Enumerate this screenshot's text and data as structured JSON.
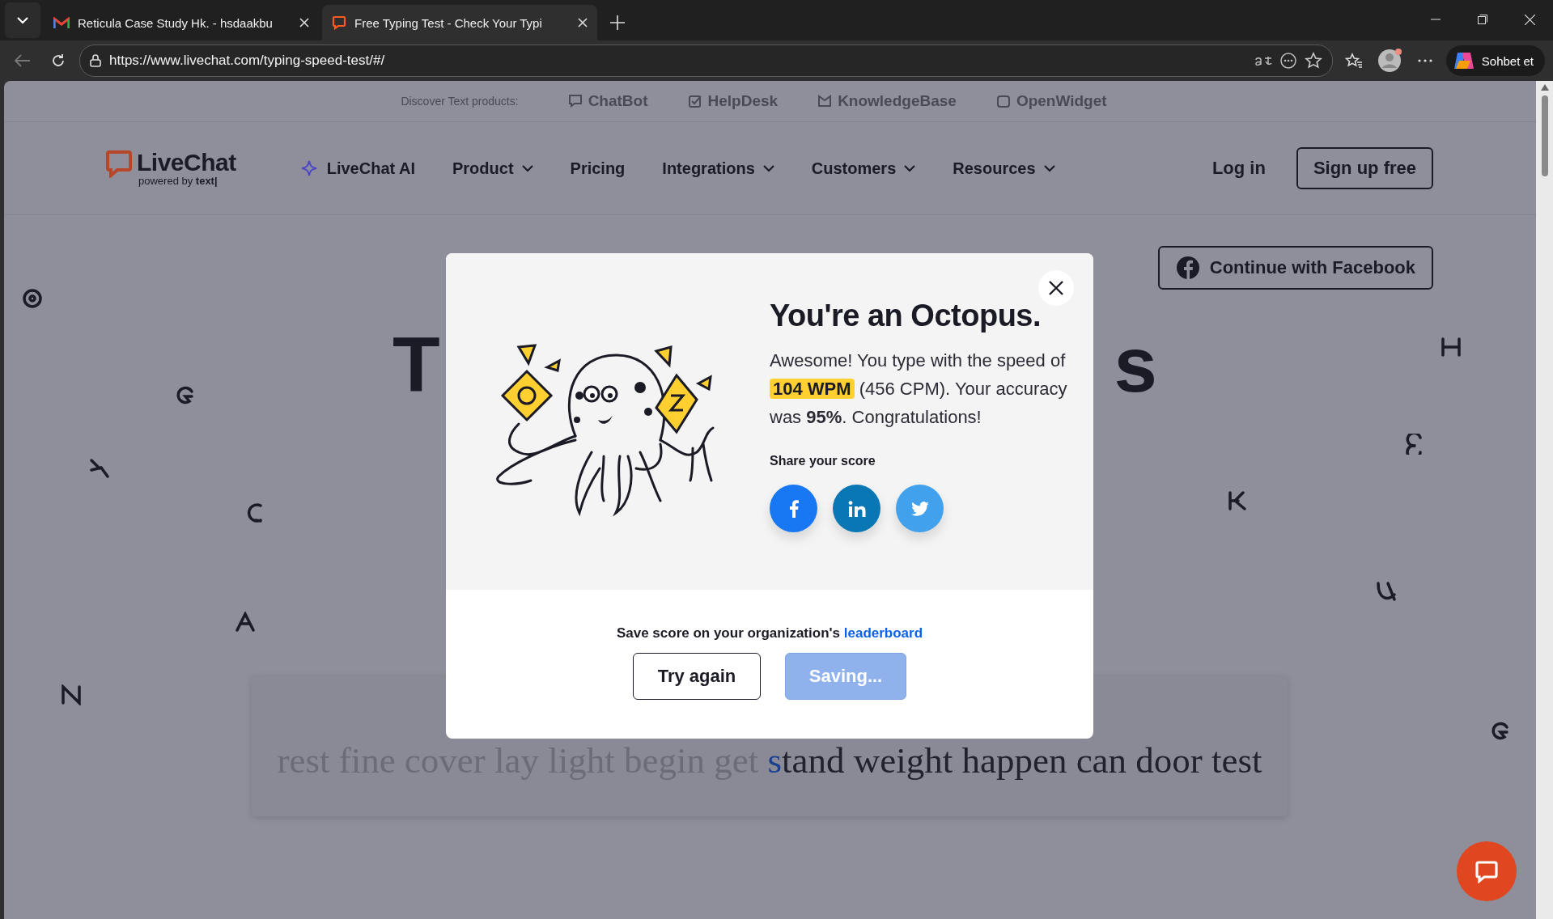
{
  "browser": {
    "tabs": [
      {
        "title": "Reticula Case Study Hk. - hsdaakbu",
        "kind": "mail",
        "selected": false
      },
      {
        "title": "Free Typing Test - Check Your Typi",
        "kind": "chat",
        "selected": true
      }
    ],
    "url": "https://www.livechat.com/typing-speed-test/#/",
    "copilot_label": "Sohbet et"
  },
  "products_bar": {
    "label": "Discover Text products:",
    "items": [
      {
        "label": "ChatBot",
        "kind": "chatbot"
      },
      {
        "label": "HelpDesk",
        "kind": "helpdesk"
      },
      {
        "label": "KnowledgeBase",
        "kind": "knowledgebase"
      },
      {
        "label": "OpenWidget",
        "kind": "openwidget"
      }
    ]
  },
  "nav": {
    "logo": "LiveChat",
    "logo_sub": "powered by **text|**",
    "items": [
      {
        "label": "LiveChat AI",
        "kind": "ai"
      },
      {
        "label": "Product",
        "kind": "dropdown"
      },
      {
        "label": "Pricing",
        "kind": "link"
      },
      {
        "label": "Integrations",
        "kind": "dropdown"
      },
      {
        "label": "Customers",
        "kind": "dropdown"
      },
      {
        "label": "Resources",
        "kind": "dropdown"
      }
    ],
    "login": "Log in",
    "signup": "Sign up free"
  },
  "facebook_button": "Continue with Facebook",
  "heading_fragments": [
    "T",
    "s"
  ],
  "typing": {
    "segments": [
      {
        "text": "rest fine cover lay light begin get ",
        "kind": "typed"
      },
      {
        "text": "s",
        "kind": "current"
      },
      {
        "text": "tand weight happen can door test",
        "kind": "pending"
      }
    ]
  },
  "modal": {
    "title": "You're an Octopus.",
    "message_before": "Awesome! You type with the speed of",
    "highlight": "104 WPM",
    "message_after": "(456 CPM). Your accuracy was **95%**. Congratulations!",
    "share_label": "Share your score",
    "share": [
      {
        "kind": "facebook"
      },
      {
        "kind": "linkedin"
      },
      {
        "kind": "twitter"
      }
    ],
    "save_text": "Save score on your organization's",
    "save_link": "leaderboard",
    "buttons": [
      {
        "label": "Try again",
        "disabled": false
      },
      {
        "label": "Saving...",
        "disabled": true
      }
    ]
  }
}
